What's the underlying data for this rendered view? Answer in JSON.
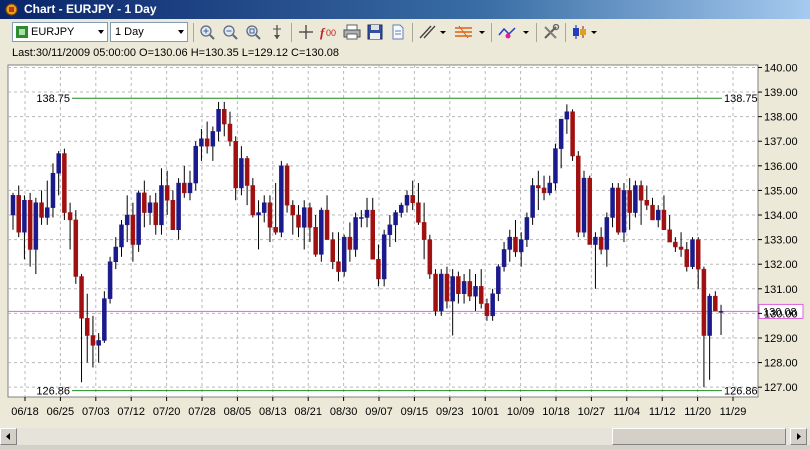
{
  "window": {
    "title": "Chart - EURJPY - 1 Day"
  },
  "toolbar": {
    "symbol": "EURJPY",
    "timeframe": "1 Day",
    "icons": [
      "zoom-in-icon",
      "zoom-out-icon",
      "zoom-reset-icon",
      "cursor-icon",
      "crosshair-icon",
      "function-icon",
      "print-icon",
      "save-icon",
      "document-icon",
      "trendline-icon",
      "fibonacci-icon",
      "indicator-icon",
      "settings-icon",
      "candlestick-icon"
    ]
  },
  "info": {
    "last": "Last:30/11/2009 05:00:00 O=130.06 H=130.35 L=129.12 C=130.08"
  },
  "colors": {
    "bull": "#1a1a8c",
    "bear": "#a01010",
    "resistance": "#1f8c1f",
    "current": "#e060e0"
  },
  "chart_data": {
    "type": "candlestick",
    "symbol": "EURJPY",
    "ylim": [
      126.6,
      140.1
    ],
    "yticks": [
      127,
      128,
      129,
      130,
      131,
      132,
      133,
      134,
      135,
      136,
      137,
      138,
      139,
      140
    ],
    "ytick_labels": [
      "127.00",
      "128.00",
      "129.00",
      "130.00",
      "131.00",
      "132.00",
      "133.00",
      "134.00",
      "135.00",
      "136.00",
      "137.00",
      "138.00",
      "139.00",
      "140.00"
    ],
    "xtick_labels": [
      "06/18",
      "06/25",
      "07/03",
      "07/12",
      "07/20",
      "07/28",
      "08/05",
      "08/13",
      "08/21",
      "08/30",
      "09/07",
      "09/15",
      "09/23",
      "10/01",
      "10/09",
      "10/18",
      "10/27",
      "11/04",
      "11/12",
      "11/20",
      "11/29"
    ],
    "levels": [
      {
        "value": 138.75,
        "label": "138.75"
      },
      {
        "value": 126.86,
        "label": "126.86"
      }
    ],
    "current": {
      "value": 130.08,
      "label": "130.08"
    },
    "candles": [
      [
        134.0,
        134.9,
        133.4,
        134.8
      ],
      [
        134.8,
        135.2,
        133.1,
        133.3
      ],
      [
        133.3,
        134.8,
        132.2,
        134.6
      ],
      [
        134.6,
        134.9,
        131.9,
        132.6
      ],
      [
        132.6,
        134.7,
        131.6,
        134.5
      ],
      [
        134.5,
        135.0,
        133.6,
        133.9
      ],
      [
        133.9,
        135.4,
        133.6,
        134.3
      ],
      [
        134.3,
        136.1,
        133.9,
        135.7
      ],
      [
        135.7,
        136.6,
        134.8,
        136.5
      ],
      [
        136.5,
        136.7,
        133.8,
        134.1
      ],
      [
        134.1,
        134.5,
        132.6,
        133.8
      ],
      [
        133.8,
        134.2,
        131.2,
        131.5
      ],
      [
        131.5,
        131.6,
        127.2,
        129.8
      ],
      [
        129.8,
        130.8,
        128.0,
        129.1
      ],
      [
        129.1,
        129.9,
        127.8,
        128.7
      ],
      [
        128.7,
        129.2,
        128.0,
        128.9
      ],
      [
        128.9,
        130.9,
        128.8,
        130.6
      ],
      [
        130.6,
        132.3,
        130.4,
        132.1
      ],
      [
        132.1,
        133.1,
        131.8,
        132.7
      ],
      [
        132.7,
        133.8,
        132.3,
        133.6
      ],
      [
        133.6,
        134.8,
        132.9,
        134.0
      ],
      [
        134.0,
        134.5,
        132.1,
        132.8
      ],
      [
        132.8,
        135.0,
        132.5,
        134.9
      ],
      [
        134.9,
        135.4,
        133.5,
        134.1
      ],
      [
        134.1,
        134.8,
        133.6,
        134.5
      ],
      [
        134.5,
        134.9,
        133.2,
        133.6
      ],
      [
        133.6,
        135.9,
        133.2,
        135.2
      ],
      [
        135.2,
        135.8,
        134.0,
        134.6
      ],
      [
        134.6,
        135.0,
        133.5,
        133.4
      ],
      [
        133.4,
        135.5,
        133.0,
        135.3
      ],
      [
        135.3,
        136.0,
        134.7,
        134.9
      ],
      [
        134.9,
        135.8,
        134.6,
        135.3
      ],
      [
        135.3,
        137.0,
        135.0,
        136.8
      ],
      [
        136.8,
        137.5,
        136.2,
        137.1
      ],
      [
        137.1,
        137.8,
        136.5,
        136.8
      ],
      [
        136.8,
        137.6,
        136.2,
        137.4
      ],
      [
        137.4,
        138.6,
        137.0,
        138.3
      ],
      [
        138.3,
        138.6,
        137.2,
        137.7
      ],
      [
        137.7,
        138.2,
        136.8,
        137.0
      ],
      [
        137.0,
        137.2,
        134.6,
        135.1
      ],
      [
        135.1,
        136.8,
        134.8,
        136.3
      ],
      [
        136.3,
        136.4,
        134.4,
        135.2
      ],
      [
        135.2,
        135.5,
        133.9,
        134.0
      ],
      [
        134.0,
        134.6,
        132.6,
        134.1
      ],
      [
        134.1,
        134.8,
        133.7,
        134.5
      ],
      [
        134.5,
        134.8,
        132.9,
        133.5
      ],
      [
        133.5,
        135.3,
        133.2,
        133.3
      ],
      [
        133.3,
        136.2,
        133.1,
        136.0
      ],
      [
        136.0,
        136.1,
        134.1,
        134.4
      ],
      [
        134.4,
        134.6,
        133.2,
        134.0
      ],
      [
        134.0,
        134.4,
        133.1,
        133.5
      ],
      [
        133.5,
        134.6,
        132.6,
        134.3
      ],
      [
        134.3,
        134.5,
        132.9,
        133.5
      ],
      [
        133.5,
        134.0,
        132.3,
        132.4
      ],
      [
        132.4,
        134.3,
        132.1,
        134.2
      ],
      [
        134.2,
        134.8,
        133.3,
        133.0
      ],
      [
        133.0,
        133.3,
        131.8,
        132.1
      ],
      [
        132.1,
        133.3,
        131.3,
        131.7
      ],
      [
        131.7,
        133.2,
        131.5,
        133.1
      ],
      [
        133.1,
        133.7,
        132.1,
        132.6
      ],
      [
        132.6,
        134.1,
        132.3,
        133.9
      ],
      [
        133.9,
        134.2,
        133.5,
        133.9
      ],
      [
        133.9,
        134.7,
        133.5,
        134.2
      ],
      [
        134.2,
        134.7,
        132.4,
        132.2
      ],
      [
        132.2,
        132.8,
        131.1,
        131.4
      ],
      [
        131.4,
        133.4,
        131.1,
        133.2
      ],
      [
        133.2,
        134.0,
        132.7,
        133.6
      ],
      [
        133.6,
        134.2,
        132.9,
        134.1
      ],
      [
        134.1,
        134.5,
        133.9,
        134.4
      ],
      [
        134.4,
        135.0,
        134.1,
        134.8
      ],
      [
        134.8,
        135.4,
        134.2,
        134.5
      ],
      [
        134.5,
        135.3,
        133.6,
        133.7
      ],
      [
        133.7,
        134.5,
        132.2,
        133.0
      ],
      [
        133.0,
        133.2,
        131.4,
        131.6
      ],
      [
        131.6,
        131.8,
        129.9,
        130.1
      ],
      [
        130.1,
        131.8,
        129.9,
        131.6
      ],
      [
        131.6,
        131.9,
        130.2,
        130.5
      ],
      [
        130.5,
        131.8,
        129.1,
        131.5
      ],
      [
        131.5,
        131.7,
        130.4,
        130.8
      ],
      [
        130.8,
        131.6,
        130.4,
        131.3
      ],
      [
        131.3,
        131.8,
        130.5,
        130.7
      ],
      [
        130.7,
        131.6,
        130.1,
        131.1
      ],
      [
        131.1,
        131.8,
        130.2,
        130.4
      ],
      [
        130.4,
        130.6,
        129.7,
        129.9
      ],
      [
        129.9,
        131.0,
        129.7,
        130.8
      ],
      [
        130.8,
        132.0,
        130.5,
        131.9
      ],
      [
        131.9,
        132.9,
        131.7,
        132.6
      ],
      [
        132.6,
        133.4,
        132.1,
        133.1
      ],
      [
        133.1,
        133.8,
        132.3,
        132.5
      ],
      [
        132.5,
        133.3,
        131.9,
        133.0
      ],
      [
        133.0,
        134.1,
        132.7,
        133.9
      ],
      [
        133.9,
        135.5,
        133.6,
        135.2
      ],
      [
        135.2,
        135.8,
        134.2,
        135.1
      ],
      [
        135.1,
        135.6,
        134.6,
        134.9
      ],
      [
        134.9,
        135.6,
        134.8,
        135.3
      ],
      [
        135.3,
        136.9,
        135.0,
        136.7
      ],
      [
        136.7,
        137.9,
        135.9,
        137.9
      ],
      [
        137.9,
        138.5,
        137.3,
        138.2
      ],
      [
        138.2,
        138.3,
        136.2,
        136.4
      ],
      [
        136.4,
        136.6,
        133.1,
        133.3
      ],
      [
        133.3,
        135.8,
        133.1,
        135.5
      ],
      [
        135.5,
        135.6,
        133.0,
        132.8
      ],
      [
        132.8,
        133.3,
        131.0,
        133.1
      ],
      [
        133.1,
        133.5,
        132.4,
        132.6
      ],
      [
        132.6,
        134.1,
        131.9,
        133.9
      ],
      [
        133.9,
        135.3,
        133.5,
        135.1
      ],
      [
        135.1,
        135.3,
        133.2,
        133.3
      ],
      [
        133.3,
        135.3,
        132.9,
        135.0
      ],
      [
        135.0,
        135.5,
        133.4,
        134.1
      ],
      [
        134.1,
        135.4,
        133.9,
        135.2
      ],
      [
        135.2,
        135.4,
        133.6,
        134.6
      ],
      [
        134.6,
        135.2,
        134.2,
        134.4
      ],
      [
        134.4,
        134.7,
        133.9,
        133.8
      ],
      [
        133.8,
        134.4,
        133.5,
        134.2
      ],
      [
        134.2,
        134.8,
        133.5,
        133.4
      ],
      [
        133.4,
        134.0,
        133.0,
        132.9
      ],
      [
        132.9,
        133.1,
        132.5,
        132.7
      ],
      [
        132.7,
        133.3,
        132.3,
        132.6
      ],
      [
        132.6,
        132.9,
        131.7,
        131.9
      ],
      [
        131.9,
        133.1,
        131.8,
        133.0
      ],
      [
        133.0,
        133.1,
        131.0,
        131.8
      ],
      [
        131.8,
        131.9,
        127.0,
        129.1
      ],
      [
        129.1,
        130.8,
        127.3,
        130.7
      ],
      [
        130.7,
        130.9,
        130.1,
        130.1
      ],
      [
        130.06,
        130.35,
        129.12,
        130.08
      ]
    ]
  }
}
